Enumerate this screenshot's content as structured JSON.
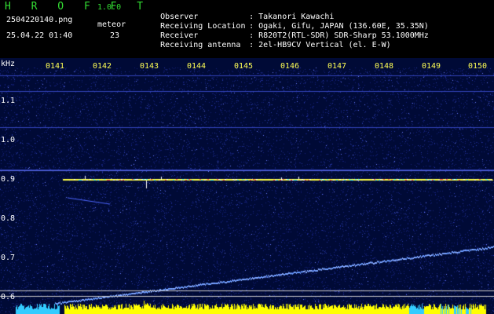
{
  "app": {
    "logo": "H R O F F T",
    "version": "1.0.0",
    "filename": "2504220140.png",
    "datetime": "25.04.22 01:40",
    "meteor_label": "meteor",
    "meteor_count": "23"
  },
  "info": [
    {
      "key": "Observer",
      "value": "Takanori Kawachi"
    },
    {
      "key": "Receiving Location",
      "value": "Ogaki, Gifu, JAPAN (136.60E, 35.35N)"
    },
    {
      "key": "Receiver",
      "value": "R820T2(RTL-SDR) SDR-Sharp 53.1000MHz"
    },
    {
      "key": "Receiving antenna",
      "value": "2el-HB9CV Vertical (el. E-W)"
    }
  ],
  "separator": ":",
  "axis": {
    "unit": "kHz",
    "time_ticks": [
      "0141",
      "0142",
      "0143",
      "0144",
      "0145",
      "0146",
      "0147",
      "0148",
      "0149",
      "0150"
    ],
    "freq_ticks": [
      "1.1",
      "1.0",
      "0.9",
      "0.8",
      "0.7",
      "0.6"
    ]
  },
  "colors": {
    "logo": "#33dd33",
    "tick_text": "#ffff55",
    "background_noise": "#000a3a",
    "carrier": "#ffff44",
    "sweep": "#6699ff",
    "bottom_bar": "#ffff00",
    "bottom_bar_alt": "#33ccff"
  }
}
